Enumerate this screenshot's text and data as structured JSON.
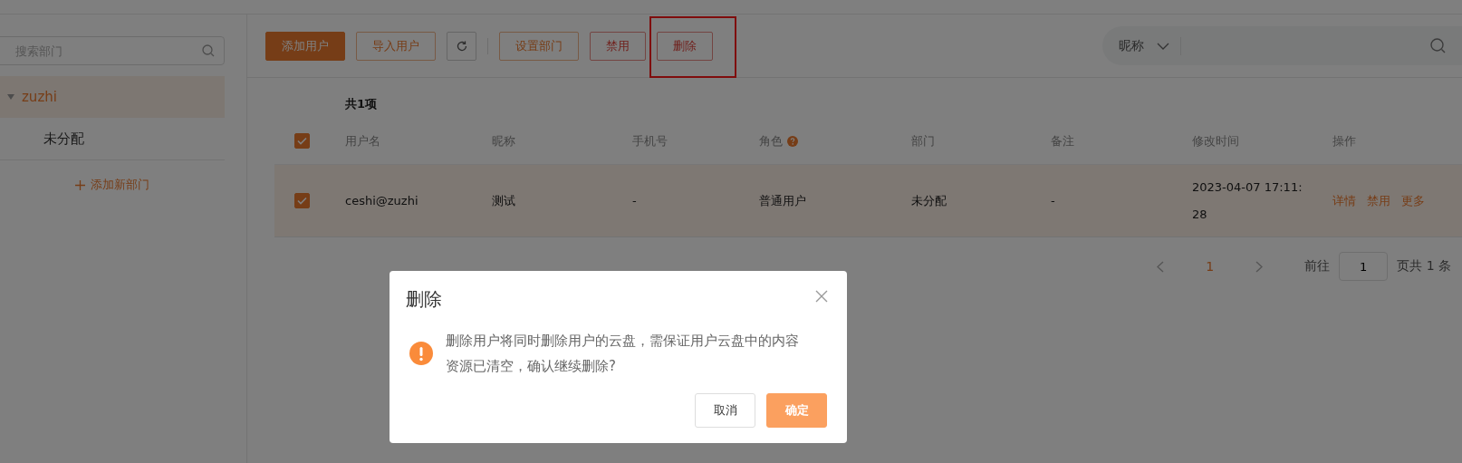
{
  "sidebar": {
    "search": {
      "placeholder": "搜索部门"
    },
    "tree": [
      {
        "label": "zuzhi",
        "selected": true,
        "expanded": true,
        "children": [
          {
            "label": "未分配",
            "selected": false
          }
        ]
      }
    ],
    "add_link": "添加新部门"
  },
  "toolbar": {
    "buttons": [
      {
        "kind": "primary",
        "label": "添加用户",
        "highlighted": false
      },
      {
        "kind": "outline",
        "label": "导入用户",
        "highlighted": false
      },
      {
        "kind": "icon",
        "highlighted": false
      },
      {
        "kind": "separator",
        "highlighted": false
      },
      {
        "kind": "outline",
        "label": "设置部门",
        "highlighted": false
      },
      {
        "kind": "danger",
        "label": "禁用",
        "highlighted": false
      },
      {
        "kind": "danger",
        "label": "删除",
        "highlighted": true
      }
    ],
    "search": {
      "filter": "昵称"
    }
  },
  "table": {
    "count": "共1项",
    "header_checked": true,
    "columns": [
      {
        "label": "用户名",
        "help": false
      },
      {
        "label": "昵称",
        "help": false
      },
      {
        "label": "手机号",
        "help": false
      },
      {
        "label": "角色",
        "help": true
      },
      {
        "label": "部门",
        "help": false
      },
      {
        "label": "备注",
        "help": false
      },
      {
        "label": "修改时间",
        "help": false
      },
      {
        "label": "操作",
        "help": false
      }
    ],
    "rows": [
      {
        "checked": true,
        "cells": [
          "ceshi@zuzhi",
          "测试",
          "-",
          "普通用户",
          "未分配",
          "-",
          "2023-04-07 17:11:28"
        ],
        "actions": [
          "详情",
          "禁用",
          "更多"
        ]
      }
    ]
  },
  "pagination": {
    "page": "1",
    "goto_label": "前往",
    "goto_value": "1",
    "total": "页共 1 条"
  },
  "dialog": {
    "title": "删除",
    "message": "删除用户将同时删除用户的云盘，需保证用户云盘中的内容资源已清空，确认继续删除?",
    "buttons": [
      {
        "kind": "default",
        "label": "取消"
      },
      {
        "kind": "primary",
        "label": "确定"
      }
    ]
  }
}
